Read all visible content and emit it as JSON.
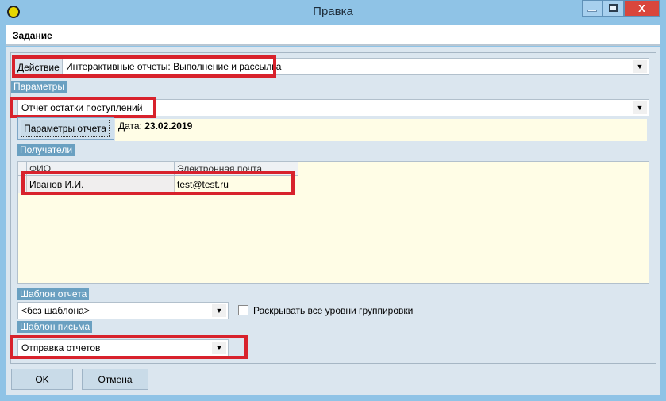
{
  "window": {
    "title": "Правка",
    "close_glyph": "X"
  },
  "header": {
    "title": "Задание"
  },
  "action": {
    "label": "Действие",
    "value": "Интерактивные отчеты: Выполнение и рассылка"
  },
  "params": {
    "section": "Параметры",
    "report": "Отчет остатки поступлений",
    "button": "Параметры отчета",
    "date_label": "Дата:",
    "date_value": "23.02.2019"
  },
  "recipients": {
    "section": "Получатели",
    "columns": [
      "ФИО",
      "Электронная почта"
    ],
    "rows": [
      {
        "name": "Иванов И.И.",
        "email": "test@test.ru"
      }
    ]
  },
  "report_template": {
    "section": "Шаблон отчета",
    "value": "<без шаблона>",
    "checkbox_label": "Раскрывать все уровни группировки",
    "checked": false
  },
  "letter_template": {
    "section": "Шаблон письма",
    "value": "Отправка отчетов"
  },
  "footer": {
    "ok": "OK",
    "cancel": "Отмена"
  },
  "colors": {
    "frame": "#8fc3e6",
    "section": "#6aa0c1",
    "highlight": "#d8222c",
    "panel": "#fffde6"
  }
}
